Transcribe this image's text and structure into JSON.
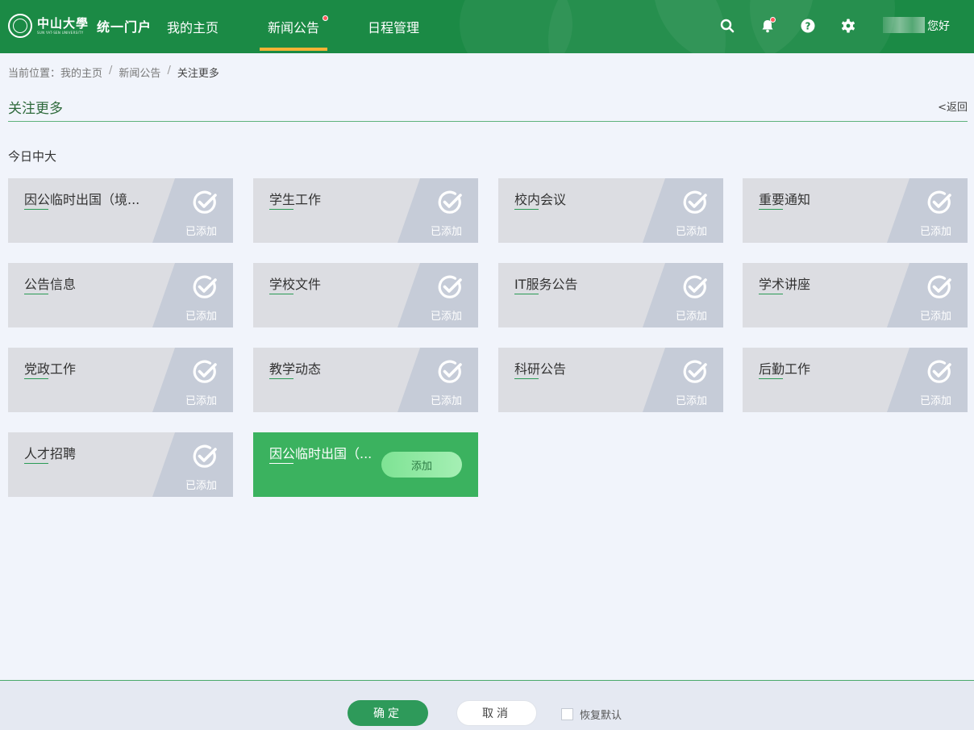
{
  "header": {
    "logo_cn": "中山大學",
    "logo_en": "SUN YAT-SEN UNIVERSITY",
    "portal_title": "统一门户",
    "nav": [
      {
        "label": "我的主页",
        "active": false
      },
      {
        "label": "新闻公告",
        "active": true,
        "has_dot": true
      },
      {
        "label": "日程管理",
        "active": false
      }
    ],
    "icons": [
      "search-icon",
      "bell-icon",
      "help-icon",
      "gear-icon"
    ],
    "greeting": "您好",
    "colors": {
      "bar": "#1b8a45",
      "active_underline": "#f5b335",
      "dot": "#ff5a5a"
    }
  },
  "breadcrumb": {
    "prefix": "当前位置：",
    "items": [
      "我的主页",
      "新闻公告",
      "关注更多"
    ],
    "separator": "/"
  },
  "page": {
    "title": "关注更多",
    "back": "<返回",
    "section": "今日中大"
  },
  "cards": [
    {
      "label": "因公临时出国（境...",
      "status": "已添加"
    },
    {
      "label": "学生工作",
      "status": "已添加"
    },
    {
      "label": "校内会议",
      "status": "已添加"
    },
    {
      "label": "重要通知",
      "status": "已添加"
    },
    {
      "label": "公告信息",
      "status": "已添加"
    },
    {
      "label": "学校文件",
      "status": "已添加"
    },
    {
      "label": "IT服务公告",
      "status": "已添加"
    },
    {
      "label": "学术讲座",
      "status": "已添加"
    },
    {
      "label": "党政工作",
      "status": "已添加"
    },
    {
      "label": "教学动态",
      "status": "已添加"
    },
    {
      "label": "科研公告",
      "status": "已添加"
    },
    {
      "label": "后勤工作",
      "status": "已添加"
    },
    {
      "label": "人才招聘",
      "status": "已添加"
    }
  ],
  "pending_card": {
    "label": "因公临时出国（...",
    "button": "添加"
  },
  "footer": {
    "confirm": "确定",
    "cancel": "取消",
    "restore": "恢复默认"
  }
}
